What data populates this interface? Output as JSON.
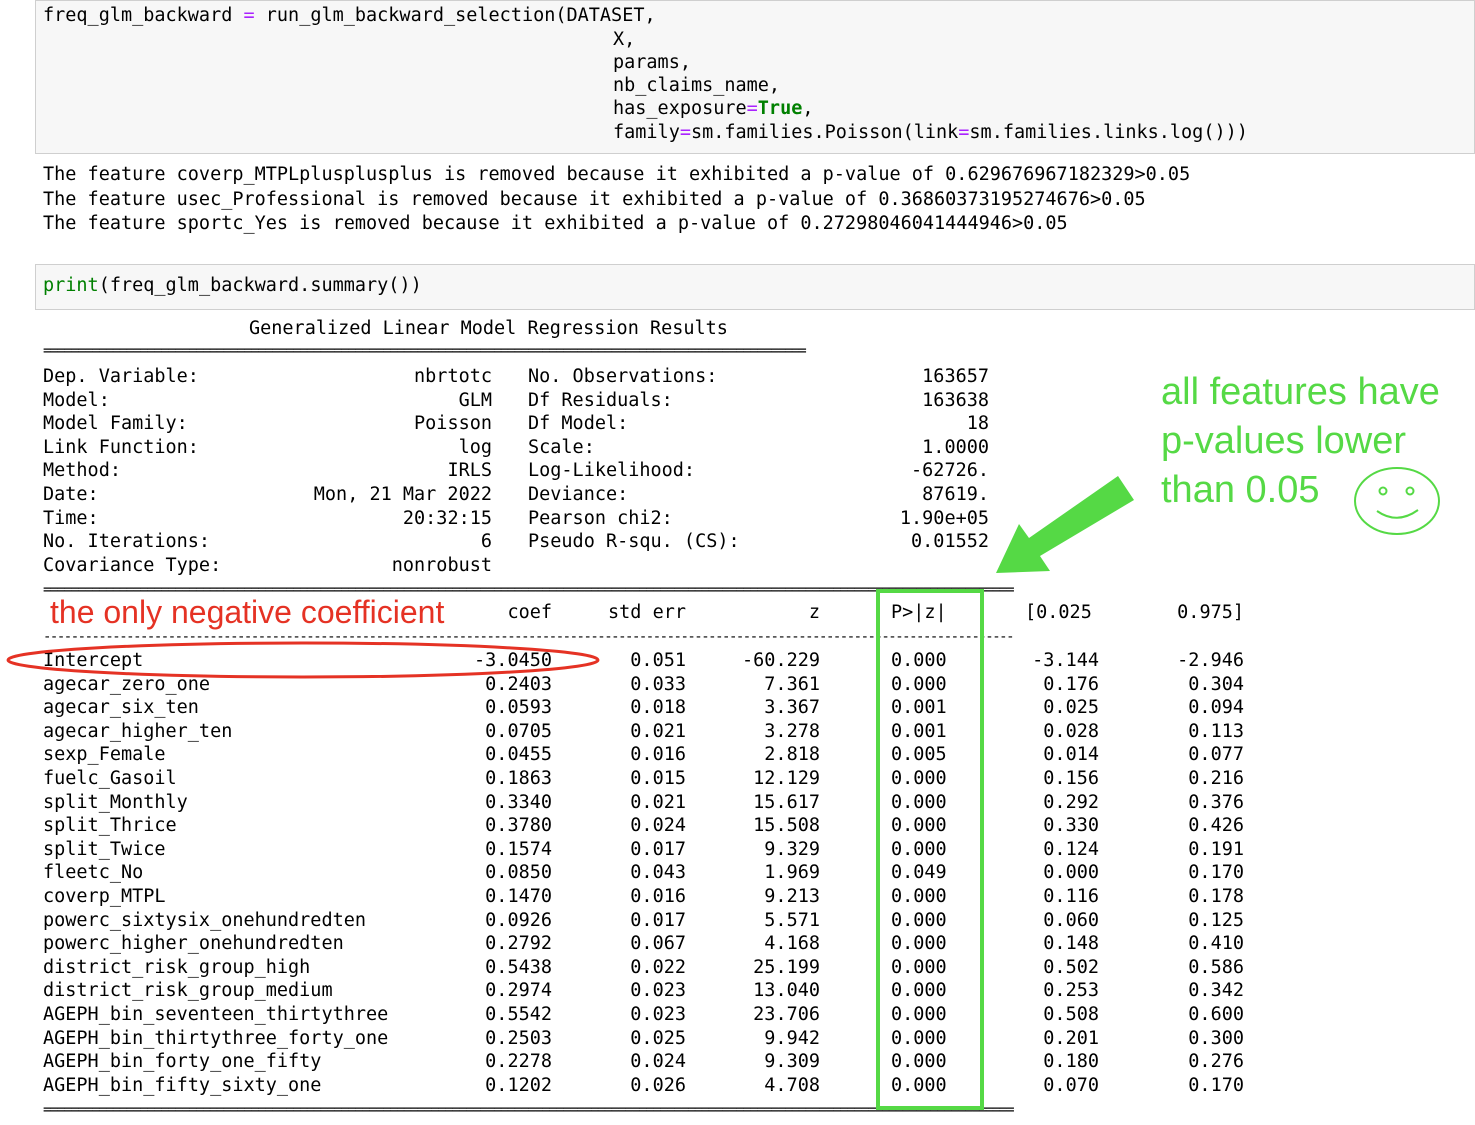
{
  "code_cell": {
    "line1_var": "freq_glm_backward",
    "line1_eq": " = ",
    "line1_call": "run_glm_backward_selection(DATASET,",
    "arg_x": "X,",
    "arg_params": "params,",
    "arg_nb": "nb_claims_name,",
    "arg_exp_name": "has_exposure",
    "arg_exp_eq": "=",
    "arg_exp_val": "True",
    "arg_exp_comma": ",",
    "arg_family_name": "family",
    "arg_family_eq": "=",
    "arg_family_mid": "sm.families.Poisson(link",
    "arg_family_eq2": "=",
    "arg_family_end": "sm.families.links.log()))"
  },
  "removal_output": [
    "The feature coverp_MTPLplusplusplus is removed because it exhibited a p-value of 0.629676967182329>0.05",
    "The feature usec_Professional is removed because it exhibited a p-value of 0.36860373195274676>0.05",
    "The feature sportc_Yes is removed because it exhibited a p-value of 0.27298046041444946>0.05"
  ],
  "print_cell": {
    "fn": "print",
    "rest": "(freq_glm_backward.summary())"
  },
  "summary": {
    "title": "Generalized Linear Model Regression Results",
    "left_info": [
      {
        "key": "Dep. Variable:",
        "val": "nbrtotc"
      },
      {
        "key": "Model:",
        "val": "GLM"
      },
      {
        "key": "Model Family:",
        "val": "Poisson"
      },
      {
        "key": "Link Function:",
        "val": "log"
      },
      {
        "key": "Method:",
        "val": "IRLS"
      },
      {
        "key": "Date:",
        "val": "Mon, 21 Mar 2022"
      },
      {
        "key": "Time:",
        "val": "20:32:15"
      },
      {
        "key": "No. Iterations:",
        "val": "6"
      },
      {
        "key": "Covariance Type:",
        "val": "nonrobust"
      }
    ],
    "right_info": [
      {
        "key": "No. Observations:",
        "val": "163657"
      },
      {
        "key": "Df Residuals:",
        "val": "163638"
      },
      {
        "key": "Df Model:",
        "val": "18"
      },
      {
        "key": "Scale:",
        "val": "1.0000"
      },
      {
        "key": "Log-Likelihood:",
        "val": "-62726."
      },
      {
        "key": "Deviance:",
        "val": "87619."
      },
      {
        "key": "Pearson chi2:",
        "val": "1.90e+05"
      },
      {
        "key": "Pseudo R-squ. (CS):",
        "val": "0.01552"
      }
    ],
    "columns": [
      "coef",
      "std err",
      "z",
      "P>|z|",
      "[0.025",
      "0.975]"
    ],
    "rows": [
      {
        "name": "Intercept",
        "coef": "-3.0450",
        "se": "0.051",
        "z": "-60.229",
        "p": "0.000",
        "lo": "-3.144",
        "hi": "-2.946"
      },
      {
        "name": "agecar_zero_one",
        "coef": "0.2403",
        "se": "0.033",
        "z": "7.361",
        "p": "0.000",
        "lo": "0.176",
        "hi": "0.304"
      },
      {
        "name": "agecar_six_ten",
        "coef": "0.0593",
        "se": "0.018",
        "z": "3.367",
        "p": "0.001",
        "lo": "0.025",
        "hi": "0.094"
      },
      {
        "name": "agecar_higher_ten",
        "coef": "0.0705",
        "se": "0.021",
        "z": "3.278",
        "p": "0.001",
        "lo": "0.028",
        "hi": "0.113"
      },
      {
        "name": "sexp_Female",
        "coef": "0.0455",
        "se": "0.016",
        "z": "2.818",
        "p": "0.005",
        "lo": "0.014",
        "hi": "0.077"
      },
      {
        "name": "fuelc_Gasoil",
        "coef": "0.1863",
        "se": "0.015",
        "z": "12.129",
        "p": "0.000",
        "lo": "0.156",
        "hi": "0.216"
      },
      {
        "name": "split_Monthly",
        "coef": "0.3340",
        "se": "0.021",
        "z": "15.617",
        "p": "0.000",
        "lo": "0.292",
        "hi": "0.376"
      },
      {
        "name": "split_Thrice",
        "coef": "0.3780",
        "se": "0.024",
        "z": "15.508",
        "p": "0.000",
        "lo": "0.330",
        "hi": "0.426"
      },
      {
        "name": "split_Twice",
        "coef": "0.1574",
        "se": "0.017",
        "z": "9.329",
        "p": "0.000",
        "lo": "0.124",
        "hi": "0.191"
      },
      {
        "name": "fleetc_No",
        "coef": "0.0850",
        "se": "0.043",
        "z": "1.969",
        "p": "0.049",
        "lo": "0.000",
        "hi": "0.170"
      },
      {
        "name": "coverp_MTPL",
        "coef": "0.1470",
        "se": "0.016",
        "z": "9.213",
        "p": "0.000",
        "lo": "0.116",
        "hi": "0.178"
      },
      {
        "name": "powerc_sixtysix_onehundredten",
        "coef": "0.0926",
        "se": "0.017",
        "z": "5.571",
        "p": "0.000",
        "lo": "0.060",
        "hi": "0.125"
      },
      {
        "name": "powerc_higher_onehundredten",
        "coef": "0.2792",
        "se": "0.067",
        "z": "4.168",
        "p": "0.000",
        "lo": "0.148",
        "hi": "0.410"
      },
      {
        "name": "district_risk_group_high",
        "coef": "0.5438",
        "se": "0.022",
        "z": "25.199",
        "p": "0.000",
        "lo": "0.502",
        "hi": "0.586"
      },
      {
        "name": "district_risk_group_medium",
        "coef": "0.2974",
        "se": "0.023",
        "z": "13.040",
        "p": "0.000",
        "lo": "0.253",
        "hi": "0.342"
      },
      {
        "name": "AGEPH_bin_seventeen_thirtythree",
        "coef": "0.5542",
        "se": "0.023",
        "z": "23.706",
        "p": "0.000",
        "lo": "0.508",
        "hi": "0.600"
      },
      {
        "name": "AGEPH_bin_thirtythree_forty_one",
        "coef": "0.2503",
        "se": "0.025",
        "z": "9.942",
        "p": "0.000",
        "lo": "0.201",
        "hi": "0.300"
      },
      {
        "name": "AGEPH_bin_forty_one_fifty",
        "coef": "0.2278",
        "se": "0.024",
        "z": "9.309",
        "p": "0.000",
        "lo": "0.180",
        "hi": "0.276"
      },
      {
        "name": "AGEPH_bin_fifty_sixty_one",
        "coef": "0.1202",
        "se": "0.026",
        "z": "4.708",
        "p": "0.000",
        "lo": "0.070",
        "hi": "0.170"
      }
    ]
  },
  "annotations": {
    "negative_note": "the only negative coefficient",
    "pvalue_note": [
      "all features have",
      "p-values lower",
      "than 0.05"
    ],
    "red_color": "#e53224",
    "green_color": "#55d945"
  }
}
